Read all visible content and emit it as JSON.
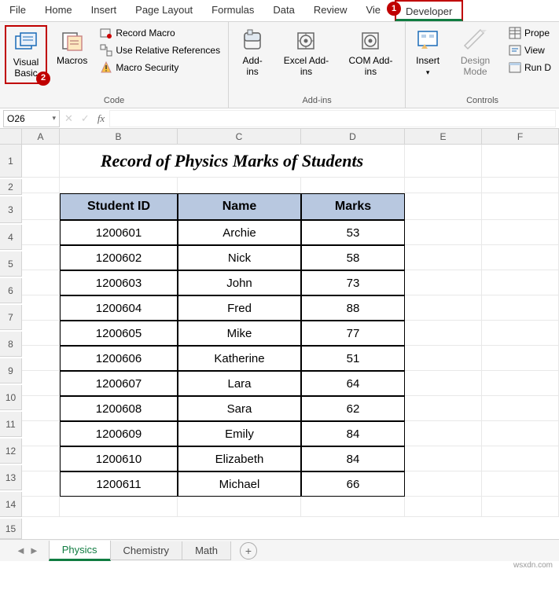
{
  "tabs": [
    "File",
    "Home",
    "Insert",
    "Page Layout",
    "Formulas",
    "Data",
    "Review",
    "Vie",
    "Developer"
  ],
  "callouts": {
    "one": "1",
    "two": "2"
  },
  "ribbon": {
    "code": {
      "visualBasic": "Visual Basic",
      "macros": "Macros",
      "recordMacro": "Record Macro",
      "useRel": "Use Relative References",
      "macroSec": "Macro Security",
      "label": "Code"
    },
    "addins": {
      "addins": "Add-ins",
      "excelAddins": "Excel Add-ins",
      "comAddins": "COM Add-ins",
      "label": "Add-ins"
    },
    "controls": {
      "insert": "Insert",
      "designMode": "Design Mode",
      "props": "Prope",
      "viewCode": "View",
      "runD": "Run D",
      "label": "Controls"
    }
  },
  "namebox": "O26",
  "cols": [
    "A",
    "B",
    "C",
    "D",
    "E",
    "F"
  ],
  "rowNums": [
    "1",
    "2",
    "3",
    "4",
    "5",
    "6",
    "7",
    "8",
    "9",
    "10",
    "11",
    "12",
    "13",
    "14",
    "15"
  ],
  "title": "Record of Physics Marks of Students",
  "headers": {
    "id": "Student ID",
    "name": "Name",
    "marks": "Marks"
  },
  "chart_data": {
    "type": "table",
    "columns": [
      "Student ID",
      "Name",
      "Marks"
    ],
    "rows": [
      [
        "1200601",
        "Archie",
        "53"
      ],
      [
        "1200602",
        "Nick",
        "58"
      ],
      [
        "1200603",
        "John",
        "73"
      ],
      [
        "1200604",
        "Fred",
        "88"
      ],
      [
        "1200605",
        "Mike",
        "77"
      ],
      [
        "1200606",
        "Katherine",
        "51"
      ],
      [
        "1200607",
        "Lara",
        "64"
      ],
      [
        "1200608",
        "Sara",
        "62"
      ],
      [
        "1200609",
        "Emily",
        "84"
      ],
      [
        "1200610",
        "Elizabeth",
        "84"
      ],
      [
        "1200611",
        "Michael",
        "66"
      ]
    ]
  },
  "sheets": [
    "Physics",
    "Chemistry",
    "Math"
  ],
  "watermark": "wsxdn.com"
}
